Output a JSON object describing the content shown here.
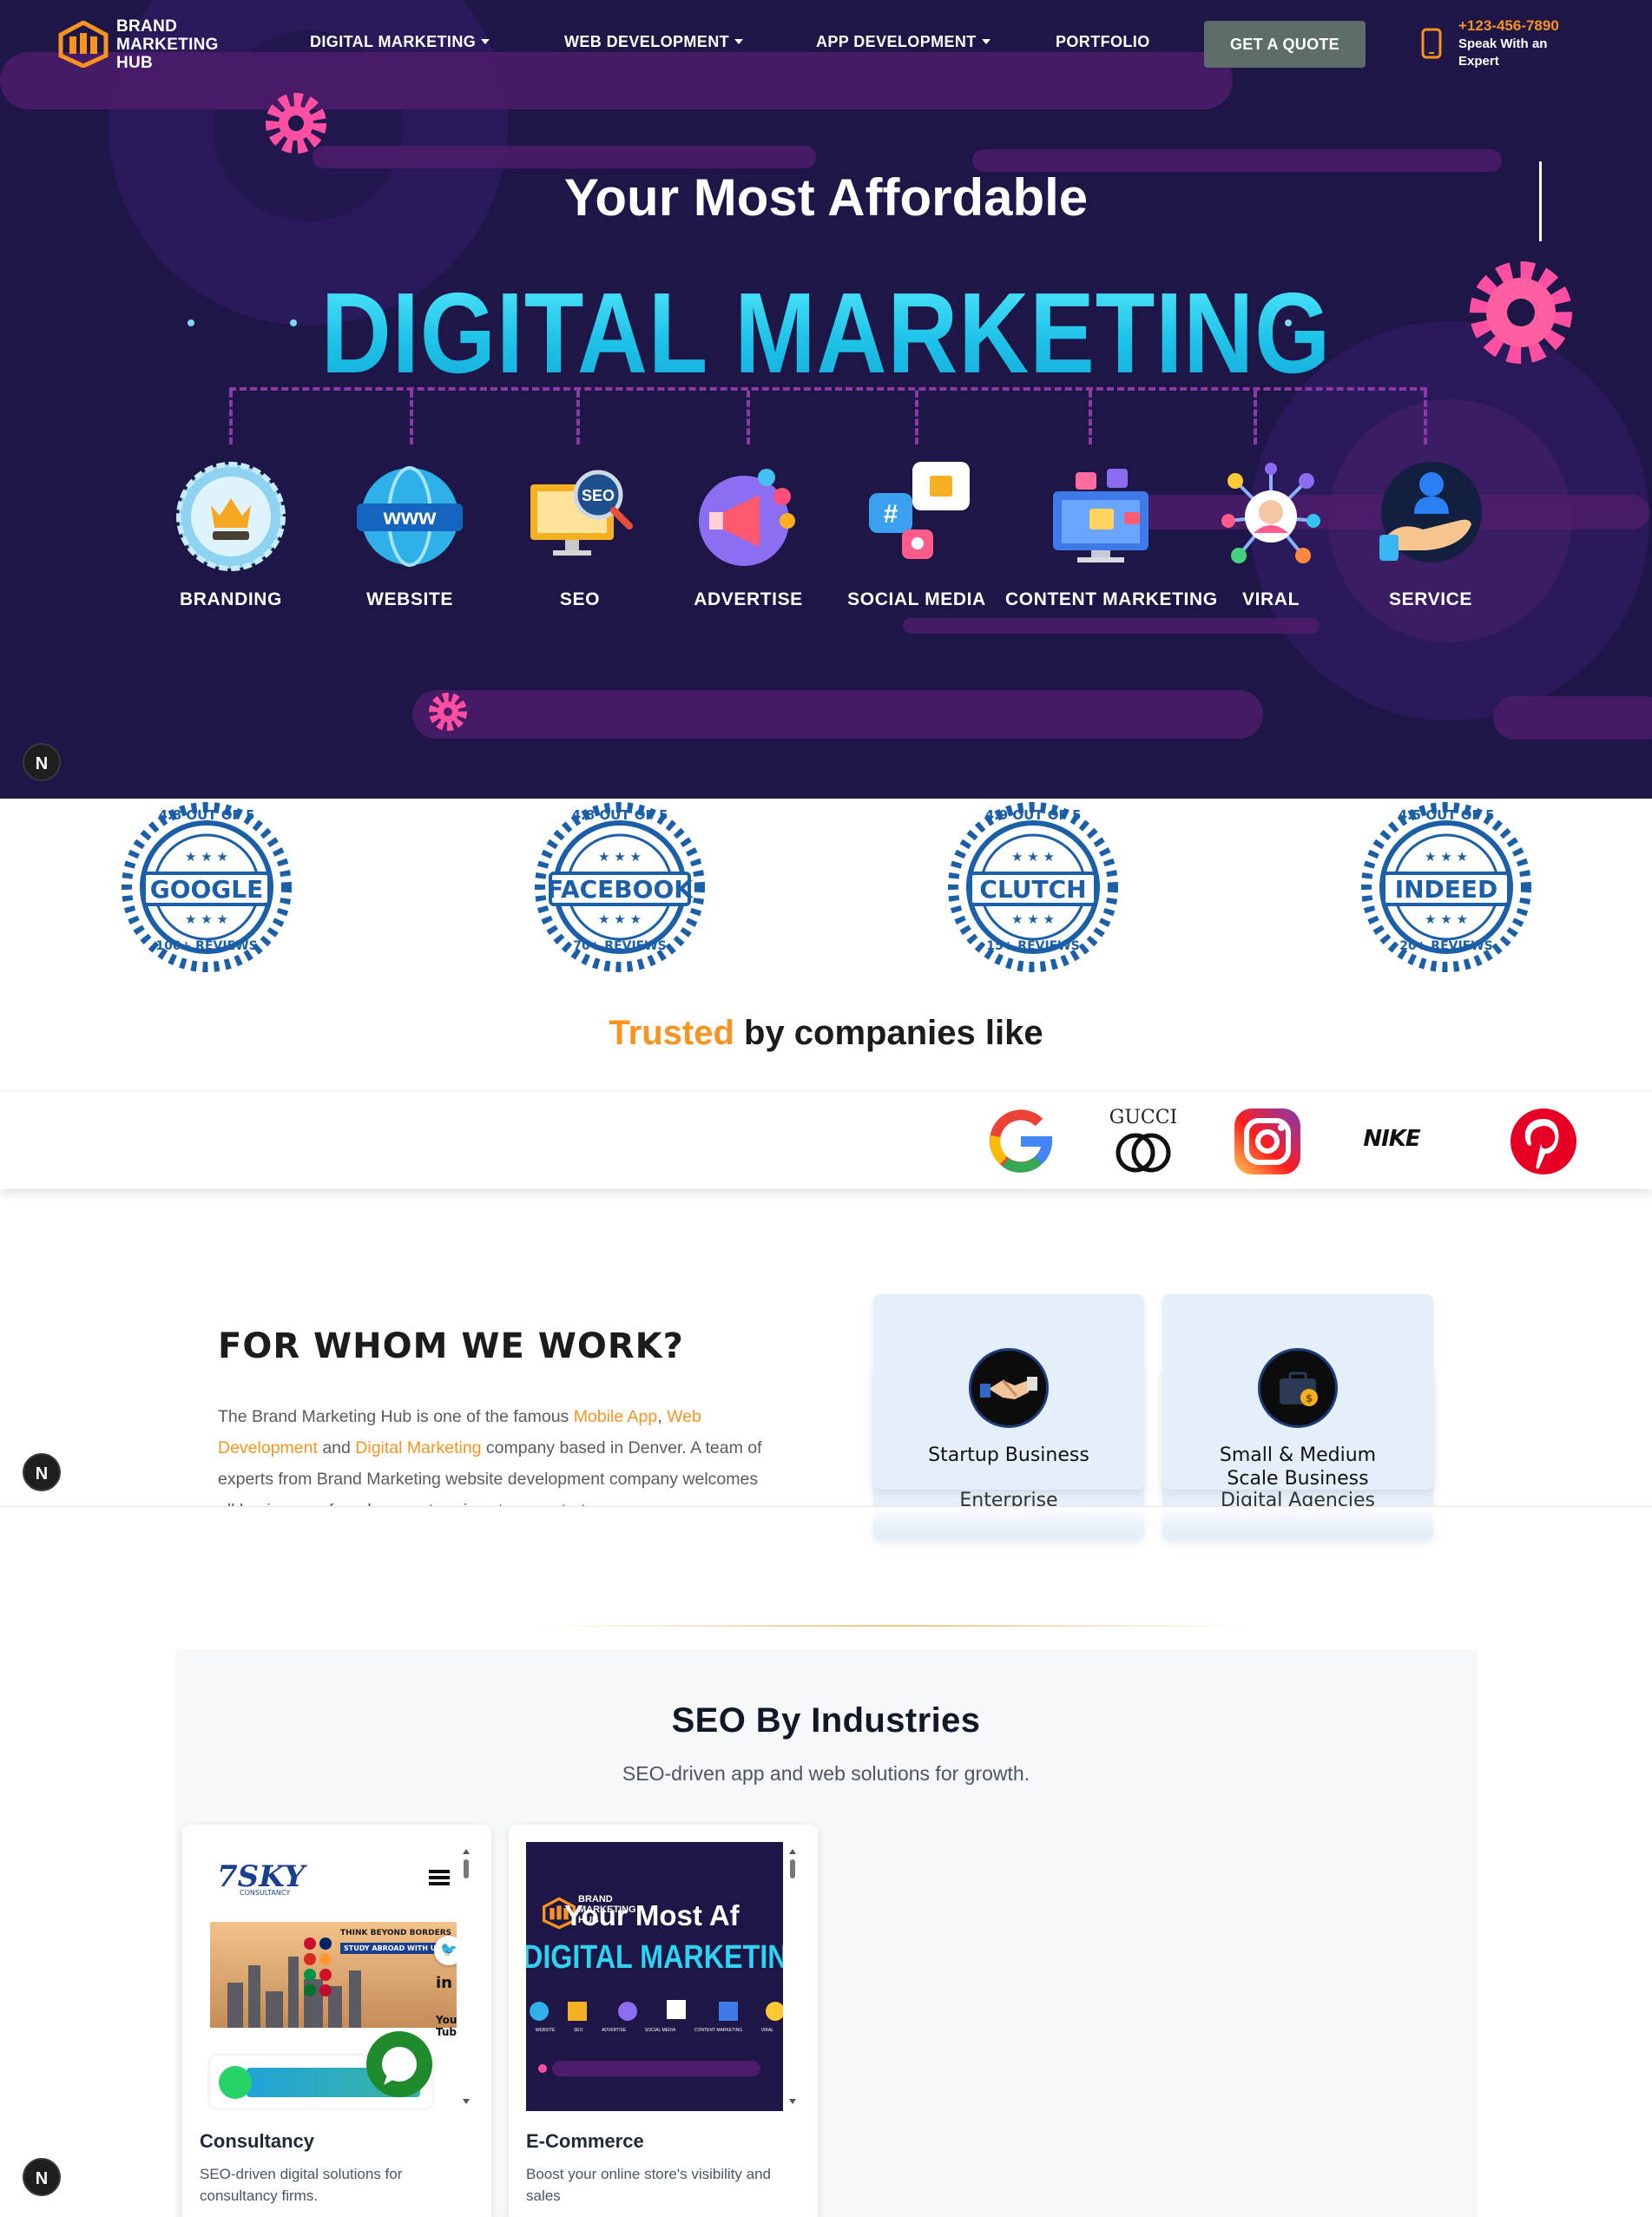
{
  "nav": {
    "logo_text": "BRAND\nMARKETING\nHUB",
    "items": [
      {
        "label": "DIGITAL MARKETING",
        "has_caret": true
      },
      {
        "label": "WEB DEVELOPMENT",
        "has_caret": true
      },
      {
        "label": "APP DEVELOPMENT",
        "has_caret": true
      },
      {
        "label": "PORTFOLIO",
        "has_caret": false
      }
    ],
    "cta": "GET A QUOTE",
    "phone": "+123-456-7890",
    "phone_sub": "Speak With an Expert"
  },
  "hero": {
    "subtitle": "Your Most Affordable",
    "title": "DIGITAL MARKETING",
    "services": [
      {
        "label": "BRANDING",
        "icon": "crown-badge-icon"
      },
      {
        "label": "WEBSITE",
        "icon": "www-globe-icon"
      },
      {
        "label": "SEO",
        "icon": "seo-monitor-icon"
      },
      {
        "label": "ADVERTISE",
        "icon": "megaphone-icon"
      },
      {
        "label": "SOCIAL MEDIA",
        "icon": "social-chat-icon"
      },
      {
        "label": "CONTENT MARKETING",
        "icon": "content-screen-icon"
      },
      {
        "label": "VIRAL",
        "icon": "viral-network-icon"
      },
      {
        "label": "SERVICE",
        "icon": "hand-person-icon"
      }
    ],
    "badge_letter": "N"
  },
  "reviews": [
    {
      "rating": "4.8 OUT OF 5",
      "platform": "GOOGLE",
      "count": "100+ REVIEWS"
    },
    {
      "rating": "4.8 OUT OF 5",
      "platform": "FACEBOOK",
      "count": "70+ REVIEWS"
    },
    {
      "rating": "4.9 OUT OF 5",
      "platform": "CLUTCH",
      "count": "15+ REVIEWS"
    },
    {
      "rating": "4.5 OUT OF 5",
      "platform": "INDEED",
      "count": "20+ REVIEWS"
    }
  ],
  "trusted": {
    "accent": "Trusted",
    "rest": " by companies like"
  },
  "brands": {
    "gucci_text": "GUCCI",
    "nike_text": "NIKE"
  },
  "whom": {
    "title": "FOR WHOM WE WORK?",
    "text_parts": [
      "The Brand Marketing Hub is one of the famous ",
      "Mobile App",
      ", ",
      "Web Development",
      " and ",
      "Digital Marketing",
      " company based in Denver. A team of experts from Brand Marketing website development company welcomes all businesses from large enterprises to new startups across"
    ],
    "cards": [
      {
        "label": "Startup Business"
      },
      {
        "label": "Small & Medium Scale Business"
      }
    ],
    "peek": [
      "Enterprise",
      "Digital Agencies"
    ]
  },
  "seo": {
    "title": "SEO By Industries",
    "subtitle": "SEO-driven app and web solutions for growth.",
    "cards": [
      {
        "name": "Consultancy",
        "desc": "SEO-driven digital solutions for consultancy firms.",
        "preview": {
          "brand": "7SKY",
          "brand_sub": "CONSULTANCY",
          "banner": "THINK BEYOND BORDERS",
          "banner_sub": "STUDY ABROAD WITH US!"
        }
      },
      {
        "name": "E-Commerce",
        "desc": "Boost your online store's visibility and sales",
        "preview": {
          "line1": "Your Most Af",
          "line2": "DIGITAL MARKETING",
          "labels": [
            "WEBSITE",
            "SEO",
            "ADVERTISE",
            "SOCIAL MEDIA",
            "CONTENT MARKETING",
            "VIRAL"
          ]
        }
      }
    ]
  },
  "colors": {
    "hero_bg": "#1d1646",
    "accent_orange": "#f7931e",
    "cyan": "#2dd3f0",
    "badge_blue": "#1a5fa8"
  }
}
